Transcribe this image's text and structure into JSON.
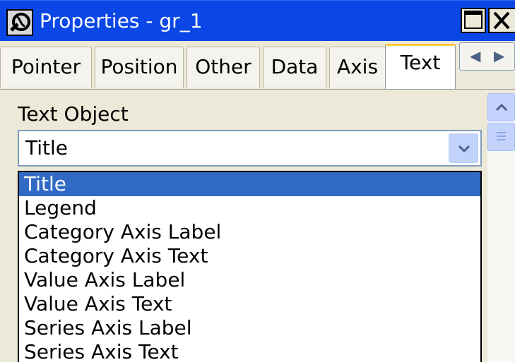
{
  "window": {
    "title": "Properties -  gr_1",
    "app_icon": "properties-app-icon",
    "maximize_icon": "maximize-icon",
    "close_icon": "close-icon"
  },
  "tabs": [
    {
      "label": "Pointer",
      "active": false
    },
    {
      "label": "Position",
      "active": false
    },
    {
      "label": "Other",
      "active": false
    },
    {
      "label": "Data",
      "active": false
    },
    {
      "label": "Axis",
      "active": false
    },
    {
      "label": "Text",
      "active": true
    }
  ],
  "tab_scroll": {
    "left_icon": "arrow-left-icon",
    "right_icon": "arrow-right-icon"
  },
  "text_object": {
    "label": "Text Object",
    "selected_value": "Title",
    "options": [
      "Title",
      "Legend",
      "Category Axis Label",
      "Category Axis Text",
      "Value Axis Label",
      "Value Axis Text",
      "Series Axis Label",
      "Series Axis Text"
    ],
    "highlighted_option": "Title"
  },
  "colors": {
    "titlebar": "#0a47e6",
    "selection": "#316ac5",
    "active_tab_accent": "#ffc83c",
    "panel_background": "#ece9d8"
  }
}
